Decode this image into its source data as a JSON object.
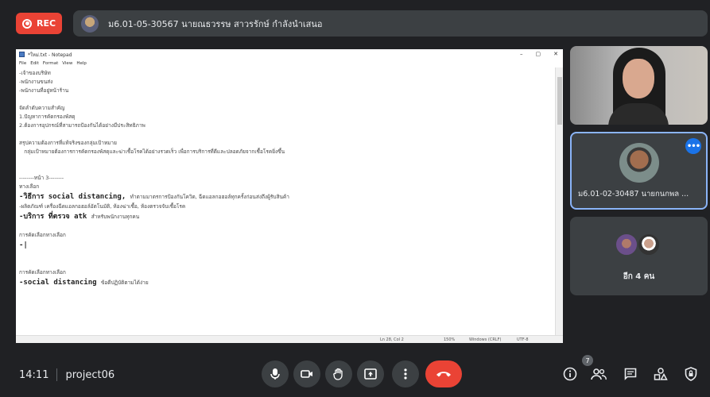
{
  "recording": {
    "label": "REC"
  },
  "presenter": {
    "text": "ม6.01-05-30567 นายณธวรรษ สาวรรักษ์ กำลังนำเสนอ"
  },
  "notepad": {
    "title": "*ใหม่.txt - Notepad",
    "window_controls": [
      "–",
      "▢",
      "✕"
    ],
    "menu": [
      "File",
      "Edit",
      "Format",
      "View",
      "Help"
    ],
    "lines": [
      {
        "text": "-เจ้าของบริษัท",
        "big": false
      },
      {
        "text": "-พนักงานขนส่ง",
        "big": false
      },
      {
        "text": "-พนักงานที่อยู่หน้าร้าน",
        "big": false
      },
      {
        "text": "",
        "big": false
      },
      {
        "text": "จัดลำดับความสำคัญ",
        "big": false
      },
      {
        "text": "1.ปัญหาการคัดกรองพัสดุ",
        "big": false
      },
      {
        "text": "2.ต้องการอุปกรณ์ที่สามารถป้องกันได้อย่างมีประสิทธิภาพ",
        "big": false
      },
      {
        "text": "",
        "big": false
      },
      {
        "text": "สรุปความต้องการที่แท้จริงของกลุ่มเป้าหมาย",
        "big": false
      },
      {
        "text": "   กลุ่มเป้าหมายต้องการการคัดกรองพัสดุและฆ่าเชื้อโรคได้อย่างรวดเร็ว เพื่อการบริการที่ดีและปลอดภัยจากเชื้อโรคยิ่งขึ้น",
        "big": false
      },
      {
        "text": "",
        "big": false
      },
      {
        "text": "",
        "big": false
      },
      {
        "text": "--------หน้า 3--------",
        "big": false
      },
      {
        "text": "ทางเลือก",
        "big": false
      },
      {
        "text": "-วิธีการ social distancing, ",
        "small": "ทำตามมาตรการป้องกันโควิด, ฉีดแอลกอฮอล์ทุกครั้งก่อนส่งถึงผู้รับสินค้า",
        "big": true
      },
      {
        "text": "-ผลิตภัณฑ์ เครื่องฉีดแอลกอฮอล์อัตโนมัติ, ห้องฆ่าเชื้อ, ห้องตรวจจับเชื้อโรค",
        "big": false
      },
      {
        "text": "-บริการ ที่ตรวจ atk ",
        "small": "สำหรับพนักงานทุกคน",
        "big": true
      },
      {
        "text": "",
        "big": false
      },
      {
        "text": "การคัดเลือกทางเลือก",
        "big": false
      },
      {
        "text": "-|",
        "big": true
      },
      {
        "text": "",
        "big": false
      },
      {
        "text": "",
        "big": false
      },
      {
        "text": "การคัดเลือกทางเลือก",
        "big": false
      },
      {
        "text": "-social distancing ",
        "small": "ข้อดีปฏิบัติตามได้ง่าย",
        "big": true
      }
    ],
    "status": {
      "position": "Ln 28, Col 2",
      "zoom": "150%",
      "line_ending": "Windows (CRLF)",
      "encoding": "UTF-8"
    }
  },
  "tiles": {
    "active_participant": {
      "name": "ม6.01-02-30487 นายกนกพล ...",
      "more_label": "•••"
    },
    "others": {
      "label": "อีก 4 คน"
    }
  },
  "meeting": {
    "time": "14:11",
    "code": "project06"
  },
  "controls": {
    "participants_count": "7",
    "icons": [
      "mic-icon",
      "camera-icon",
      "raise-hand-icon",
      "present-icon",
      "more-vert-icon",
      "hangup-icon"
    ],
    "right_icons": [
      "info-icon",
      "people-icon",
      "chat-icon",
      "activities-icon",
      "host-controls-icon"
    ]
  },
  "colors": {
    "background": "#202124",
    "rec": "#ea4335",
    "accent": "#1a73e8",
    "hangup": "#ea4335"
  }
}
